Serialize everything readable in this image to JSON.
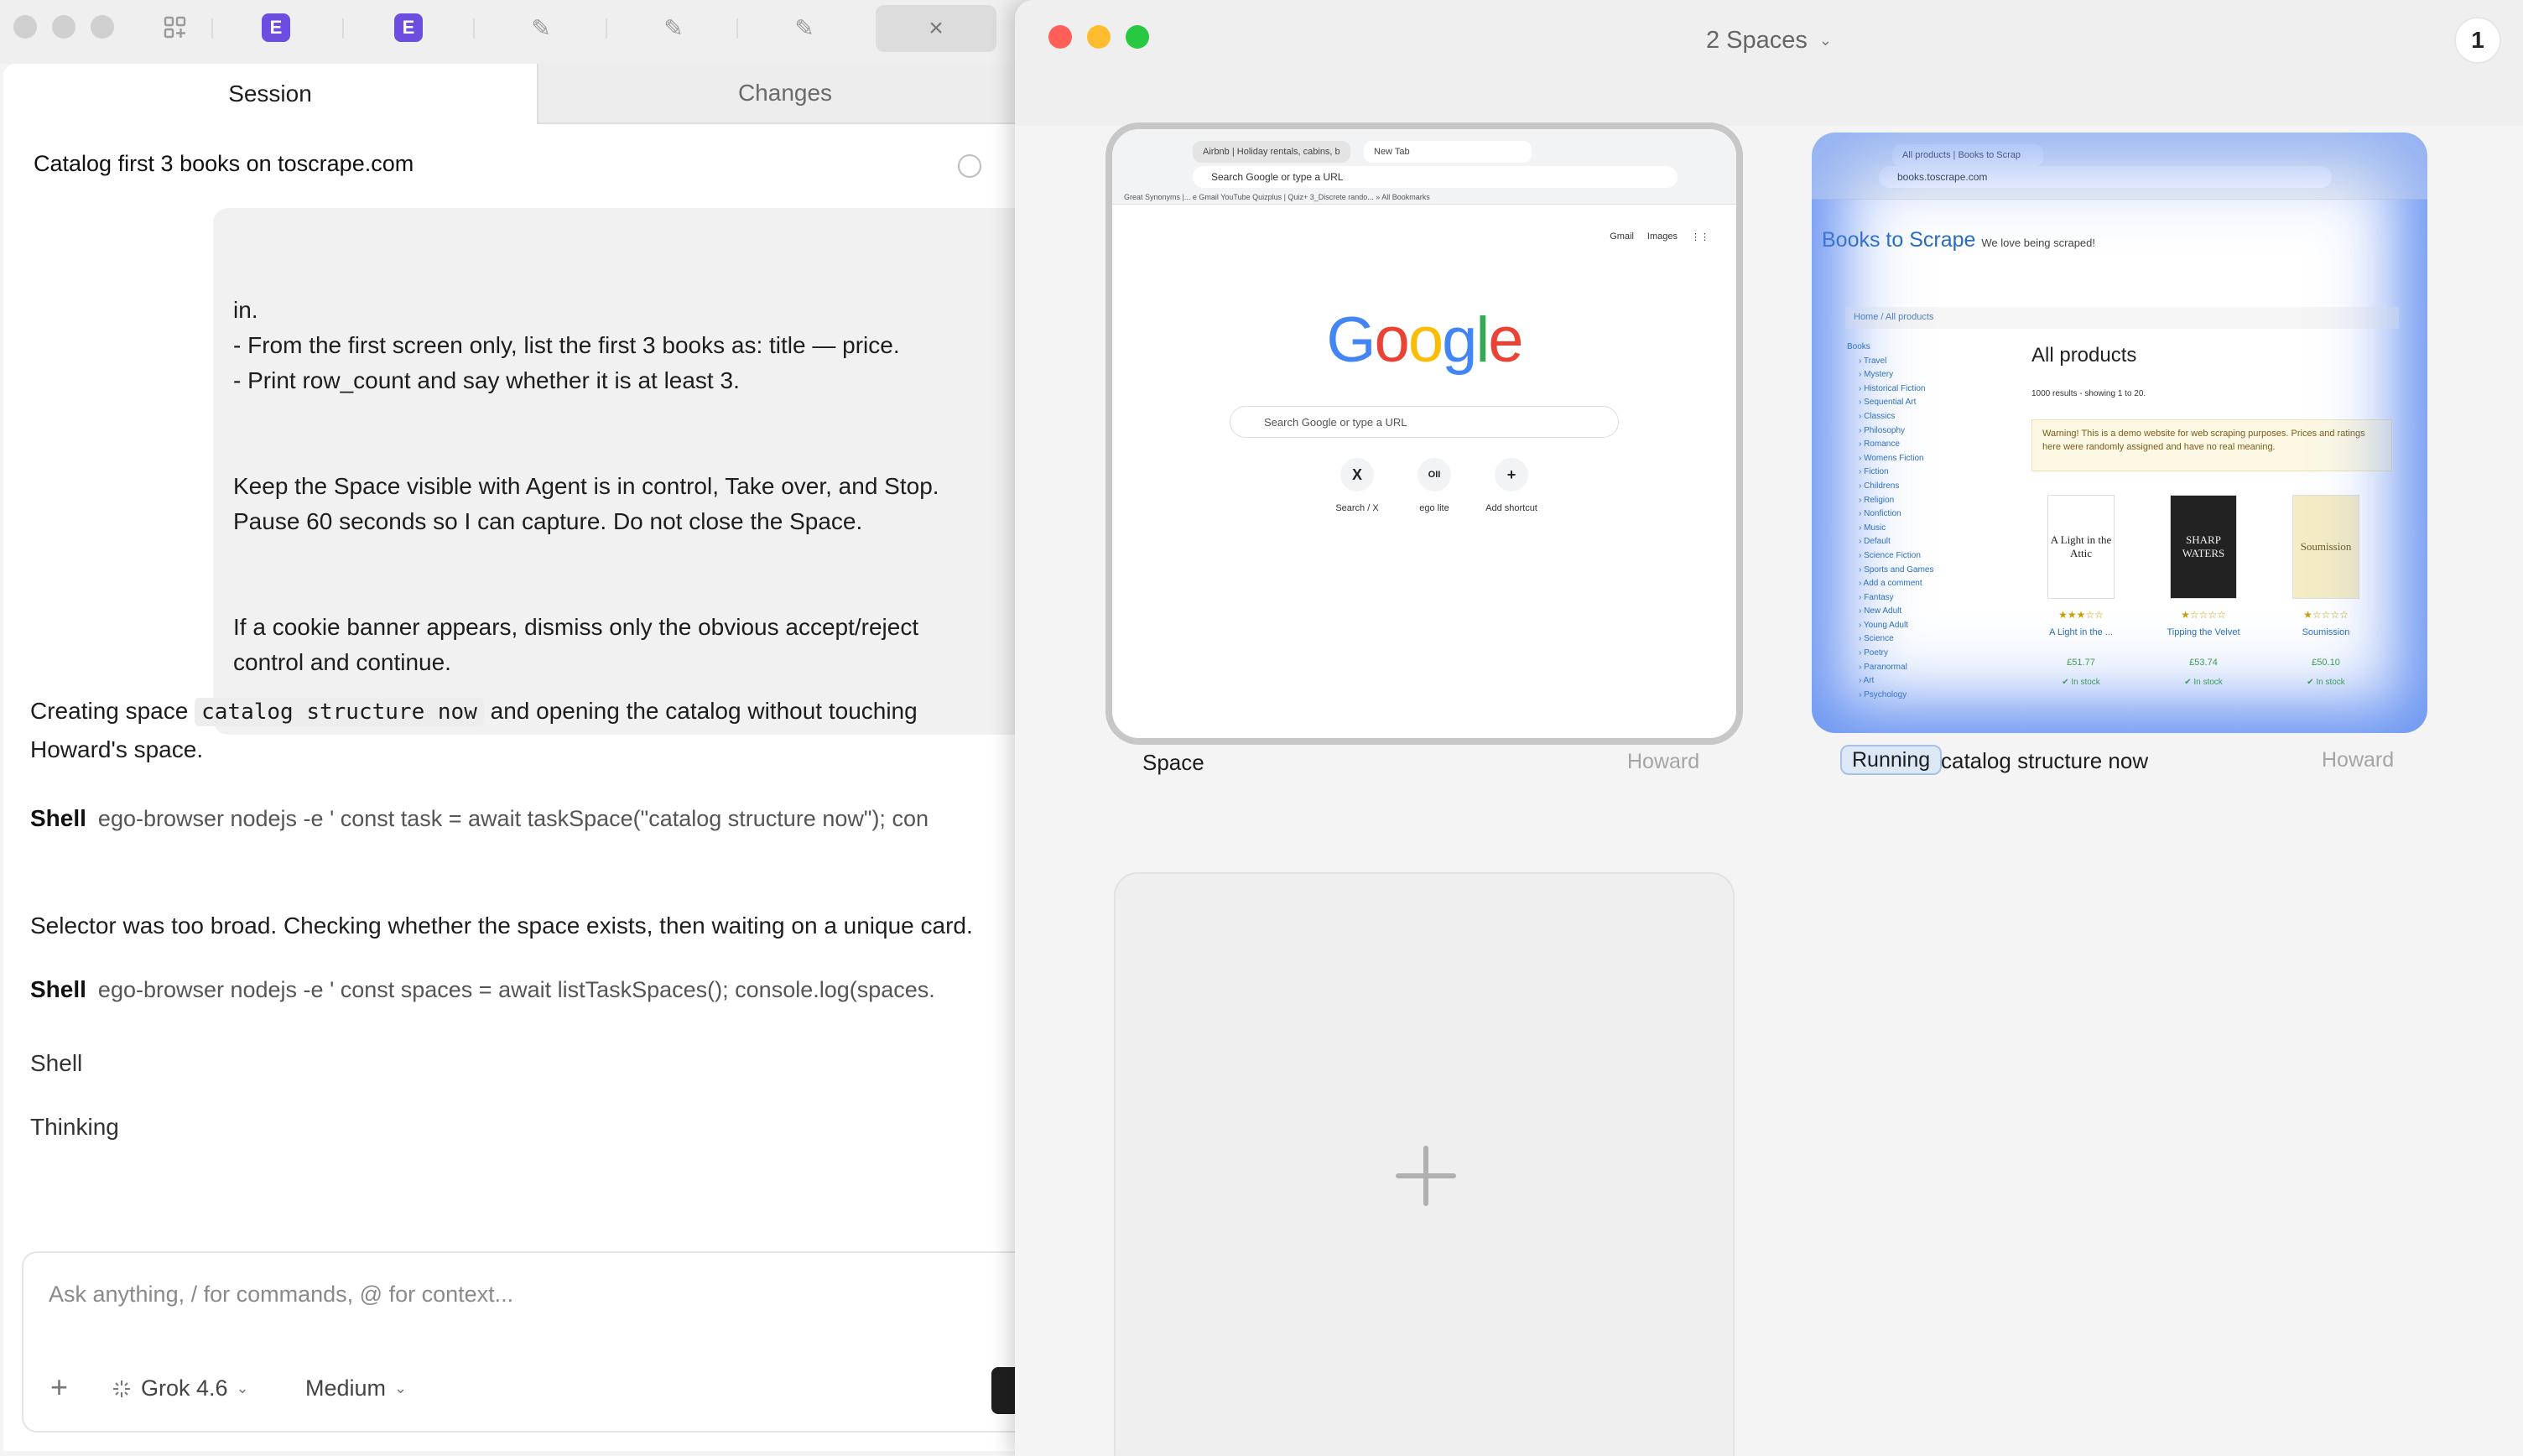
{
  "toolbar": {
    "close_glyph": "×",
    "edit_icons": [
      "✎",
      "✎",
      "✎"
    ],
    "badge_letter": "E"
  },
  "tabs": {
    "session": "Session",
    "changes": "Changes"
  },
  "session": {
    "title": "Catalog first 3 books on toscrape.com",
    "user_message": [
      "in.",
      "- From the first screen only, list the first 3 books as: title — price.",
      "- Print row_count and say whether it is at least 3.",
      "Keep the Space visible with Agent is in control, Take over, and Stop.",
      "Pause 60 seconds so I can capture. Do not close the Space.",
      "If a cookie banner appears, dismiss only the obvious accept/reject",
      "control and continue."
    ],
    "assistant_1_pre": "Creating space",
    "assistant_1_code": "catalog structure now",
    "assistant_1_post": "and opening the catalog without touching",
    "assistant_1_line2": "Howard's space.",
    "shell_label": "Shell",
    "shell_1": "ego-browser nodejs -e ' const task = await taskSpace(\"catalog structure now\"); con",
    "assistant_2": "Selector was too broad. Checking whether the space exists, then waiting on a unique card.",
    "shell_2": "ego-browser nodejs -e ' const spaces = await listTaskSpaces(); console.log(spaces.",
    "shell_3_label": "Shell",
    "thinking_label": "Thinking"
  },
  "composer": {
    "placeholder": "Ask anything, / for commands, @ for context...",
    "plus": "+",
    "model": "Grok 4.6",
    "effort": "Medium"
  },
  "spaces_panel": {
    "selector": "2 Spaces",
    "count": "1",
    "space1": {
      "label": "Space",
      "owner": "Howard",
      "preview": {
        "tab1": "Airbnb | Holiday rentals, cabins, b",
        "tab2": "New Tab",
        "address": "Search Google or type a URL",
        "bookmarks": "Great Synonyms |...   e   Gmail   YouTube   Quizplus | Quiz+   3_Discrete rando...   »   All Bookmarks",
        "links": [
          "Gmail",
          "Images"
        ],
        "search_placeholder": "Search Google or type a URL",
        "shortcuts": [
          {
            "icon": "X",
            "label": "Search / X"
          },
          {
            "icon": "OII",
            "label": "ego lite"
          },
          {
            "icon": "+",
            "label": "Add shortcut"
          }
        ]
      }
    },
    "space2": {
      "status": "Running",
      "label": "catalog structure now",
      "owner": "Howard",
      "preview": {
        "tab": "All products | Books to Scrap",
        "address": "books.toscrape.com",
        "site_title": "Books to Scrape",
        "tagline": "We love being scraped!",
        "breadcrumb": "Home  /  All products",
        "categories": [
          "Books",
          "Travel",
          "Mystery",
          "Historical Fiction",
          "Sequential Art",
          "Classics",
          "Philosophy",
          "Romance",
          "Womens Fiction",
          "Fiction",
          "Childrens",
          "Religion",
          "Nonfiction",
          "Music",
          "Default",
          "Science Fiction",
          "Sports and Games",
          "Add a comment",
          "Fantasy",
          "New Adult",
          "Young Adult",
          "Science",
          "Poetry",
          "Paranormal",
          "Art",
          "Psychology"
        ],
        "heading": "All products",
        "results": "1000 results - showing 1 to 20.",
        "warning": "Warning! This is a demo website for web scraping purposes. Prices and ratings here were randomly assigned and have no real meaning.",
        "books": [
          {
            "cover": "A Light in the Attic",
            "title": "A Light in the ...",
            "price": "£51.77",
            "stock": "✔ In stock",
            "stars": "★★★☆☆"
          },
          {
            "cover": "SHARP WATERS",
            "title": "Tipping the Velvet",
            "price": "£53.74",
            "stock": "✔ In stock",
            "stars": "★☆☆☆☆"
          },
          {
            "cover": "Soumission",
            "title": "Soumission",
            "price": "£50.10",
            "stock": "✔ In stock",
            "stars": "★☆☆☆☆"
          }
        ]
      }
    },
    "new_space_icon": "plus-icon"
  }
}
